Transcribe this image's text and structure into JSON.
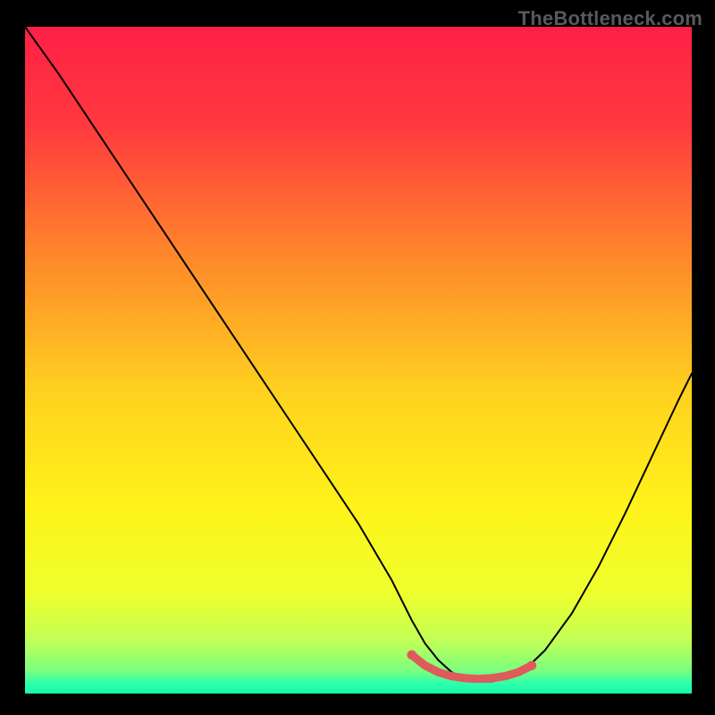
{
  "watermark": "TheBottleneck.com",
  "chart_data": {
    "type": "line",
    "title": "",
    "xlabel": "",
    "ylabel": "",
    "xlim": [
      0,
      100
    ],
    "ylim": [
      0,
      100
    ],
    "background_gradient": {
      "stops": [
        {
          "offset": 0.0,
          "color": "#ff1f46"
        },
        {
          "offset": 0.15,
          "color": "#ff3a3f"
        },
        {
          "offset": 0.35,
          "color": "#ff8a2a"
        },
        {
          "offset": 0.55,
          "color": "#ffd21f"
        },
        {
          "offset": 0.72,
          "color": "#fff31a"
        },
        {
          "offset": 0.85,
          "color": "#eeff2d"
        },
        {
          "offset": 0.92,
          "color": "#c2ff57"
        },
        {
          "offset": 0.965,
          "color": "#7dff7d"
        },
        {
          "offset": 0.985,
          "color": "#2dffad"
        },
        {
          "offset": 1.0,
          "color": "#17f7a8"
        }
      ]
    },
    "curve": {
      "x": [
        0,
        5,
        10,
        15,
        20,
        25,
        30,
        35,
        40,
        45,
        50,
        55,
        58,
        60,
        62,
        64,
        66,
        68,
        70,
        72,
        75,
        78,
        82,
        86,
        90,
        94,
        98,
        100
      ],
      "y": [
        100,
        93,
        85.5,
        78,
        70.5,
        63,
        55.5,
        48,
        40.5,
        33,
        25.5,
        17,
        11,
        7.5,
        5,
        3.2,
        2.2,
        1.8,
        1.8,
        2.2,
        3.6,
        6.5,
        12,
        19,
        27,
        35.5,
        44,
        48
      ],
      "stroke": "#000000",
      "width": 2.0
    },
    "flat_marker": {
      "x": [
        58,
        60,
        62,
        64,
        66,
        68,
        70,
        72,
        74,
        76
      ],
      "y": [
        5.8,
        4.2,
        3.2,
        2.6,
        2.3,
        2.2,
        2.3,
        2.6,
        3.2,
        4.2
      ],
      "color": "#df5a5a",
      "radius": 4.6
    }
  }
}
